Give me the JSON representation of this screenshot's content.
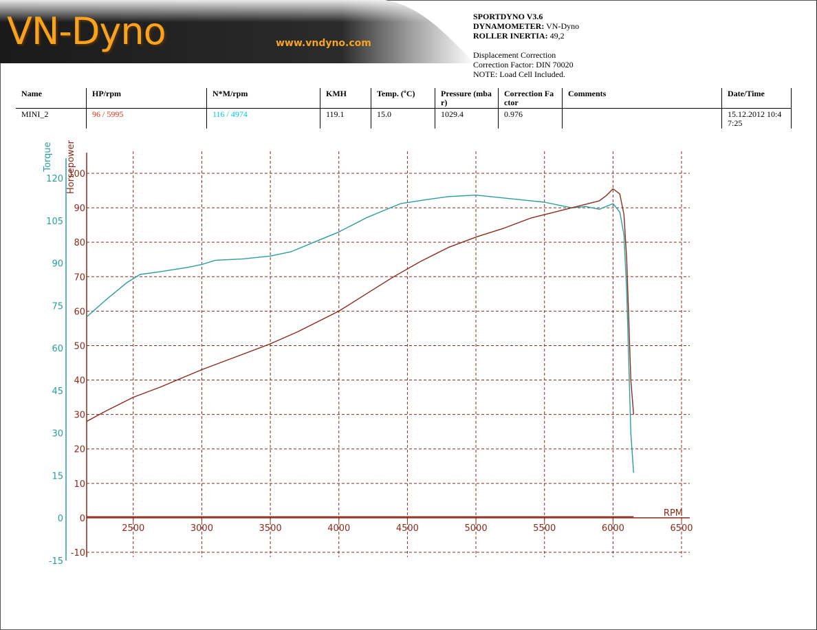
{
  "header": {
    "brand": "VN-Dyno",
    "url": "www.vndyno.com",
    "software": "SPORTDYNO V3.6",
    "dynamometer_label": "DYNAMOMETER:",
    "dynamometer_value": "VN-Dyno",
    "inertia_label": "ROLLER INERTIA:",
    "inertia_value": "49,2",
    "displacement": "Displacement Correction",
    "correction": "Correction Factor: DIN 70020",
    "note": "NOTE: Load Cell Included."
  },
  "table": {
    "headers": [
      "Name",
      "HP/rpm",
      "N*M/rpm",
      "KMH",
      "Temp. (ºC)",
      "Pressure (mba r)",
      "Correction Fa ctor",
      "Comments",
      "Date/Time"
    ],
    "row": {
      "name": "MINI_2",
      "hp": "96 / 5995",
      "nm": "116 / 4974",
      "kmh": "119.1",
      "temp": "15.0",
      "pressure": "1029.4",
      "correction": "0.976",
      "comments": "",
      "datetime": "15.12.2012 10:4 7:25"
    }
  },
  "colors": {
    "torque": "#2a9d9d",
    "power": "#8b2a1a",
    "grid": "#8b2a1a",
    "brand": "#f5a320"
  },
  "chart_data": {
    "type": "line",
    "xlabel": "RPM",
    "x_ticks": [
      2500,
      3000,
      3500,
      4000,
      4500,
      5000,
      5500,
      6000,
      6500
    ],
    "xlim": [
      2160,
      6560
    ],
    "torque_axis": {
      "label": "Torque",
      "ticks": [
        -15,
        0,
        15,
        30,
        45,
        60,
        75,
        90,
        105,
        120
      ],
      "ylim": [
        -15,
        120
      ]
    },
    "power_axis": {
      "label": "Horsepower",
      "ticks": [
        -10,
        0,
        10,
        20,
        30,
        40,
        50,
        60,
        70,
        80,
        90,
        100
      ],
      "ylim": [
        -10,
        100
      ]
    },
    "series": [
      {
        "name": "Torque",
        "axis": "torque",
        "x": [
          2160,
          2300,
          2450,
          2550,
          2700,
          2900,
          3000,
          3100,
          3300,
          3500,
          3650,
          3800,
          4000,
          4200,
          4300,
          4450,
          4650,
          4800,
          5000,
          5200,
          5500,
          5700,
          5800,
          5900,
          6000,
          6050,
          6080,
          6100,
          6130,
          6150
        ],
        "y": [
          71,
          77,
          83,
          86,
          87,
          88.5,
          89.5,
          91,
          91.5,
          92.5,
          94,
          97,
          101,
          106,
          108,
          111,
          112.5,
          113.5,
          114,
          113,
          111.5,
          109.5,
          110,
          109,
          111,
          108,
          100,
          80,
          30,
          16
        ]
      },
      {
        "name": "Horsepower",
        "axis": "power",
        "x": [
          2160,
          2300,
          2500,
          2700,
          3000,
          3300,
          3500,
          3700,
          4000,
          4200,
          4400,
          4600,
          4800,
          5000,
          5200,
          5400,
          5600,
          5800,
          5900,
          5950,
          6000,
          6050,
          6080,
          6100,
          6130,
          6150
        ],
        "y": [
          28,
          31,
          35,
          38,
          43,
          47.5,
          50.5,
          54,
          60,
          65,
          70,
          74.5,
          78.5,
          81.5,
          84,
          87,
          89,
          91,
          92,
          93.5,
          95.5,
          94,
          88,
          75,
          40,
          30
        ]
      }
    ]
  }
}
